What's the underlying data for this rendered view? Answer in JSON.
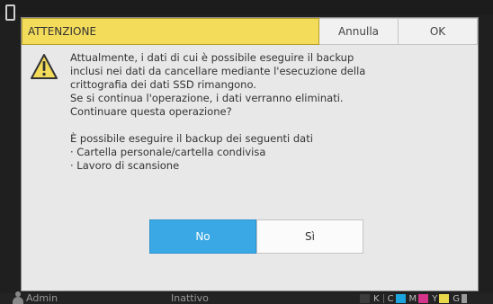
{
  "background": {
    "user": "Admin",
    "status": "Inattivo",
    "toner": [
      "K",
      "C",
      "M",
      "Y",
      "G"
    ],
    "toner_colors": {
      "K": "#3c3c3c",
      "C": "#1aa3dc",
      "M": "#d6338a",
      "Y": "#e8d64a",
      "G": "#9a9a9a"
    }
  },
  "dialog": {
    "title": "ATTENZIONE",
    "cancel_label": "Annulla",
    "ok_label": "OK",
    "icon": "warning-triangle-icon",
    "message_lines": [
      "Attualmente, i dati di cui è possibile eseguire il backup",
      "inclusi nei dati da cancellare mediante l'esecuzione della",
      "crittografia dei dati SSD rimangono.",
      "Se si continua l'operazione, i dati verranno eliminati.",
      "Continuare questa operazione?"
    ],
    "detail_lines": [
      "È possibile eseguire il backup dei seguenti dati",
      "· Cartella personale/cartella condivisa",
      "· Lavoro di scansione"
    ],
    "no_label": "No",
    "yes_label": "Sì"
  },
  "colors": {
    "title_bg": "#f4dc5b",
    "primary_button": "#3aa8e5"
  }
}
